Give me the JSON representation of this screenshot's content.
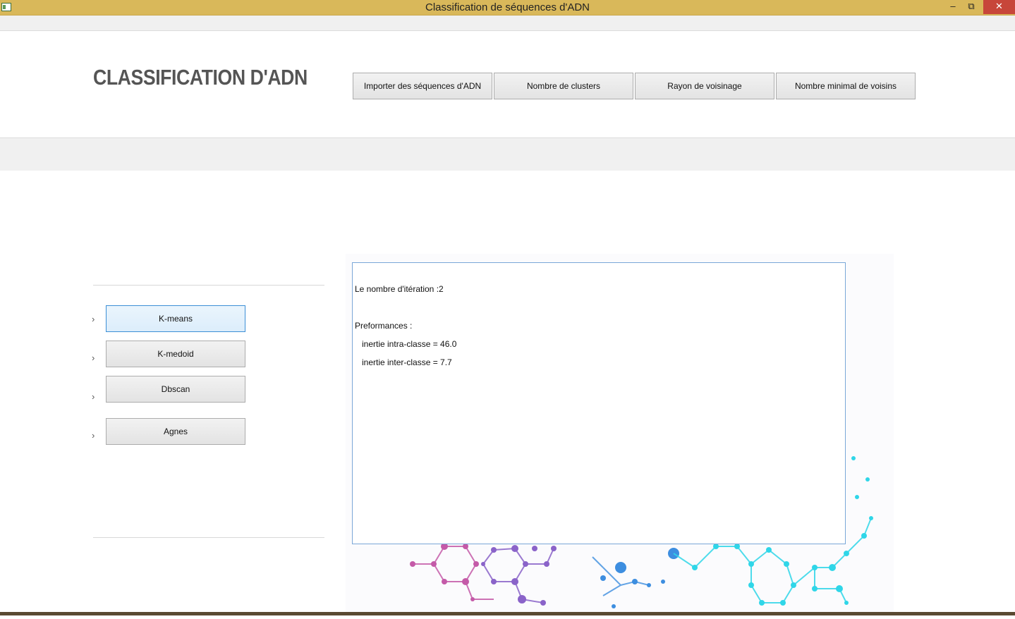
{
  "window": {
    "title": "Classification de séquences d'ADN",
    "minimize_label": "–",
    "maximize_label": "⧉",
    "close_label": "✕"
  },
  "header": {
    "app_title": "CLASSIFICATION D'ADN",
    "buttons": [
      "Importer des séquences d'ADN",
      "Nombre de clusters",
      "Rayon de voisinage",
      "Nombre minimal de voisins"
    ]
  },
  "sidebar": {
    "chevron": "›",
    "items": [
      {
        "label": "K-means",
        "active": true
      },
      {
        "label": "K-medoid",
        "active": false
      },
      {
        "label": "Dbscan",
        "active": false
      },
      {
        "label": "Agnes",
        "active": false
      }
    ]
  },
  "output": {
    "iterations_line": "Le nombre d'itération :2",
    "perf_heading": "Preformances :",
    "intra_line": "   inertie intra-classe = 46.0",
    "inter_line": "   inertie inter-classe = 7.7"
  },
  "colors": {
    "titlebar": "#d9b85a",
    "close": "#c7463a",
    "active_border": "#3c8fd6",
    "molecule_pink": "#c45aa8",
    "molecule_purple": "#8a63c9",
    "molecule_blue": "#3d8ee0",
    "molecule_cyan": "#2fd6e8"
  }
}
